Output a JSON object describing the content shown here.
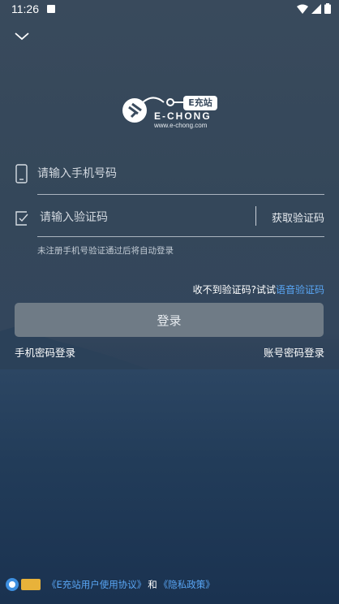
{
  "status_bar": {
    "time": "11:26"
  },
  "logo": {
    "brand": "E-CHONG",
    "badge": "E充站",
    "url": "www.e-chong.com"
  },
  "form": {
    "phone_placeholder": "请输入手机号码",
    "code_placeholder": "请输入验证码",
    "get_code_label": "获取验证码",
    "hint": "未注册手机号验证通过后将自动登录"
  },
  "voice": {
    "prefix": "收不到验证码?试试",
    "link": "语音验证码"
  },
  "login_button": "登录",
  "alt_login": {
    "left": "手机密码登录",
    "right": "账号密码登录"
  },
  "agreement": {
    "user_agreement": "《E充站用户使用协议》",
    "and": "和",
    "privacy": "《隐私政策》"
  },
  "colors": {
    "accent": "#59a6f5",
    "button": "#6f7b86"
  }
}
